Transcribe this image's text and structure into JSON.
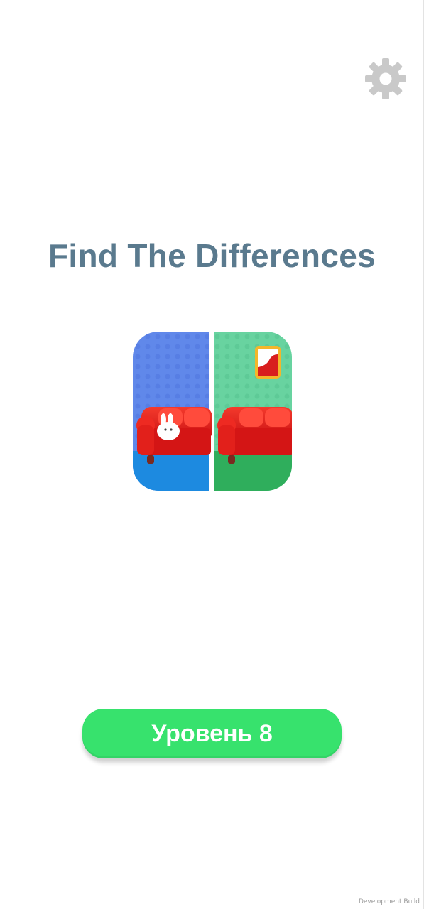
{
  "title": "Find The Differences",
  "settings": {
    "icon": "gear-icon"
  },
  "logo": {
    "icon": "two-sofas-logo"
  },
  "level_button": {
    "label": "Уровень 8"
  },
  "footer": {
    "build_note": "Development Build"
  },
  "colors": {
    "title": "#5a7a8e",
    "button": "#37e26d",
    "gear": "#c9c9c9",
    "sofa": "#e31d1d",
    "left_wall": "#5b84e8",
    "right_wall": "#63cf9c"
  }
}
